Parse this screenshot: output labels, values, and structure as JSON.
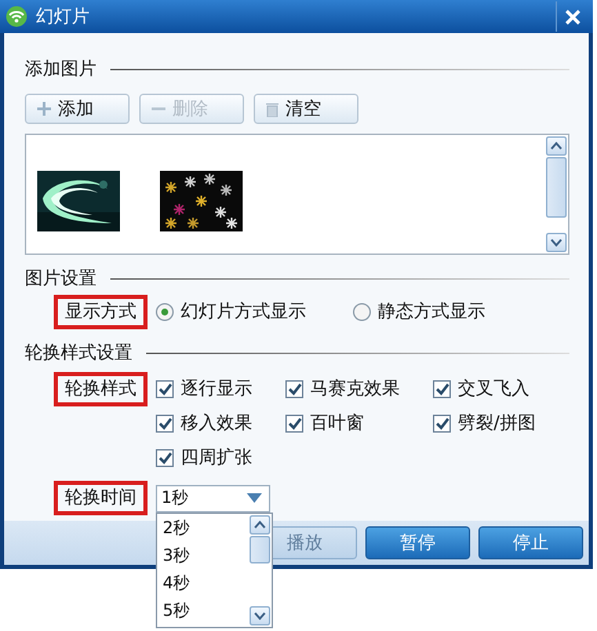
{
  "window": {
    "title": "幻灯片"
  },
  "add_pictures": {
    "heading": "添加图片",
    "buttons": [
      {
        "kind": "add",
        "label": "添加",
        "disabled": false
      },
      {
        "kind": "remove",
        "label": "删除",
        "disabled": true
      },
      {
        "kind": "clear",
        "label": "清空",
        "disabled": false
      }
    ]
  },
  "picture_settings": {
    "heading": "图片设置",
    "label": "显示方式",
    "highlighted": true,
    "options": [
      {
        "label": "幻灯片方式显示",
        "selected": true
      },
      {
        "label": "静态方式显示",
        "selected": false
      }
    ]
  },
  "transition_settings": {
    "heading": "轮换样式设置",
    "style": {
      "label": "轮换样式",
      "highlighted": true,
      "effects": [
        {
          "label": "逐行显示",
          "checked": true
        },
        {
          "label": "马赛克效果",
          "checked": true
        },
        {
          "label": "交叉飞入",
          "checked": true
        },
        {
          "label": "移入效果",
          "checked": true
        },
        {
          "label": "百叶窗",
          "checked": true
        },
        {
          "label": "劈裂/拼图",
          "checked": true
        },
        {
          "label": "四周扩张",
          "checked": true
        }
      ]
    },
    "time": {
      "label": "轮换时间",
      "highlighted": true,
      "value": "1秒",
      "expanded": true,
      "options": [
        "2秒",
        "3秒",
        "4秒",
        "5秒"
      ]
    }
  },
  "footer_buttons": [
    {
      "label": "播放",
      "disabled": true
    },
    {
      "label": "暂停",
      "disabled": false
    },
    {
      "label": "停止",
      "disabled": false
    }
  ]
}
